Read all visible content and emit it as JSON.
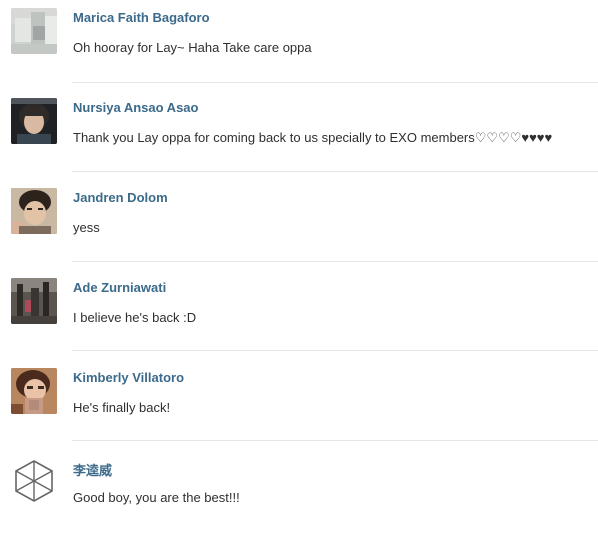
{
  "comments": [
    {
      "author": "Marica Faith Bagaforo",
      "text": "Oh hooray for Lay~ Haha Take care oppa",
      "avatar_icon": "avatar-photo-blurred"
    },
    {
      "author": "Nursiya Ansao Asao",
      "text": "Thank you Lay oppa for coming back to us specially to EXO members♡♡♡♡♥♥♥♥",
      "avatar_icon": "avatar-photo-person"
    },
    {
      "author": "Jandren Dolom",
      "text": "yess",
      "avatar_icon": "avatar-photo-person"
    },
    {
      "author": "Ade Zurniawati",
      "text": "I believe he's back :D",
      "avatar_icon": "avatar-photo-scene"
    },
    {
      "author": "Kimberly Villatoro",
      "text": "He's finally back!",
      "avatar_icon": "avatar-photo-person-blurred"
    },
    {
      "author": "李逵威",
      "text": "Good boy, you are the best!!!",
      "avatar_icon": "exo-logo-hexagon"
    }
  ],
  "colors": {
    "author": "#3b6a8a",
    "text": "#2f2f2f",
    "divider": "#e6e6e6"
  }
}
